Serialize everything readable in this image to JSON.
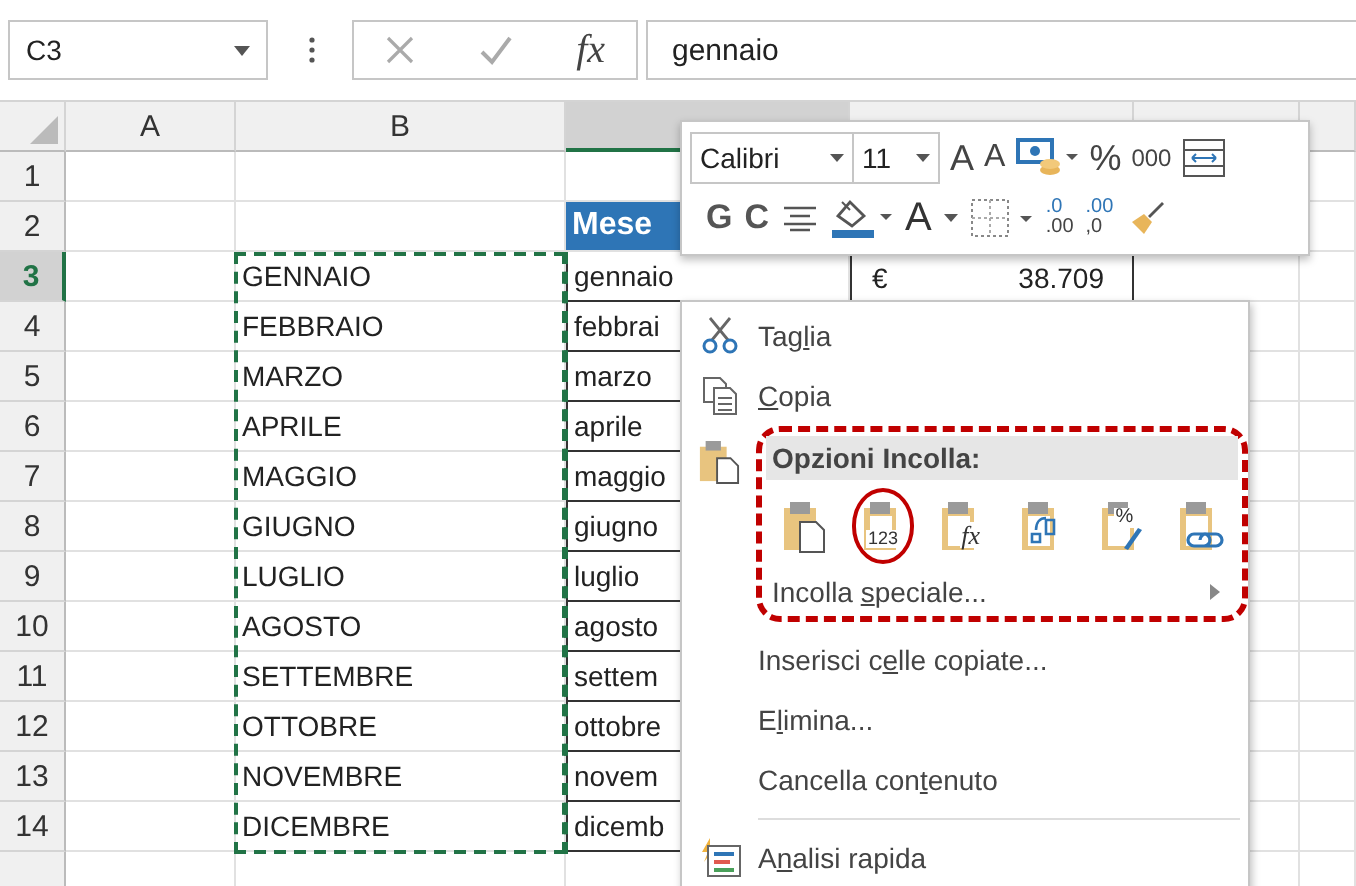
{
  "name_box": {
    "value": "C3"
  },
  "formula_bar": {
    "fx": "fx",
    "value": "gennaio"
  },
  "columns": [
    {
      "label": "A",
      "selected": false
    },
    {
      "label": "B",
      "selected": false
    },
    {
      "selected": true
    }
  ],
  "rows": [
    {
      "number": "1",
      "selected": false
    },
    {
      "number": "2",
      "selected": false,
      "c": {
        "text": "Mese",
        "kind": "header"
      }
    },
    {
      "number": "3",
      "selected": true,
      "b": "GENNAIO",
      "c": {
        "text": "gennaio",
        "kind": "table"
      },
      "d": {
        "currency": "€",
        "amount": "38.709"
      }
    },
    {
      "number": "4",
      "selected": false,
      "b": "FEBBRAIO",
      "c": {
        "text": "febbrai",
        "kind": "table"
      }
    },
    {
      "number": "5",
      "selected": false,
      "b": "MARZO",
      "c": {
        "text": "marzo",
        "kind": "table"
      }
    },
    {
      "number": "6",
      "selected": false,
      "b": "APRILE",
      "c": {
        "text": "aprile",
        "kind": "table"
      }
    },
    {
      "number": "7",
      "selected": false,
      "b": "MAGGIO",
      "c": {
        "text": "maggio",
        "kind": "table"
      }
    },
    {
      "number": "8",
      "selected": false,
      "b": "GIUGNO",
      "c": {
        "text": "giugno",
        "kind": "table"
      }
    },
    {
      "number": "9",
      "selected": false,
      "b": "LUGLIO",
      "c": {
        "text": "luglio",
        "kind": "table"
      }
    },
    {
      "number": "10",
      "selected": false,
      "b": "AGOSTO",
      "c": {
        "text": "agosto",
        "kind": "table"
      }
    },
    {
      "number": "11",
      "selected": false,
      "b": "SETTEMBRE",
      "c": {
        "text": "settem",
        "kind": "table"
      }
    },
    {
      "number": "12",
      "selected": false,
      "b": "OTTOBRE",
      "c": {
        "text": "ottobre",
        "kind": "table"
      }
    },
    {
      "number": "13",
      "selected": false,
      "b": "NOVEMBRE",
      "c": {
        "text": "novem",
        "kind": "table"
      }
    },
    {
      "number": "14",
      "selected": false,
      "b": "DICEMBRE",
      "c": {
        "text": "dicemb",
        "kind": "table"
      }
    }
  ],
  "mini_toolbar": {
    "font": "Calibri",
    "size": "11",
    "grow": "A",
    "shrink": "A",
    "percent": "%",
    "thousands": "000",
    "bold": "G",
    "italic": "C",
    "font_color": "A",
    "decimals": [
      {
        "top": ".0",
        "bottom": ".00"
      },
      {
        "top": ".00",
        "bottom": ",0"
      }
    ]
  },
  "context_menu": {
    "items": [
      {
        "kind": "cut",
        "label": {
          "pre": "Tag",
          "key": "l",
          "post": "ia"
        }
      },
      {
        "kind": "copy",
        "label": {
          "key": "C",
          "post": "opia"
        }
      },
      {
        "kind": "paste",
        "title": "Opzioni Incolla:",
        "highlighted": true,
        "options": [
          {
            "kind": "paste",
            "circled": false
          },
          {
            "kind": "values",
            "glyph": "123",
            "circled": true
          },
          {
            "kind": "formulas",
            "glyph": "fx",
            "circled": false
          },
          {
            "kind": "transpose",
            "circled": false
          },
          {
            "kind": "formatting",
            "glyph": "%",
            "circled": false
          },
          {
            "kind": "link",
            "circled": false
          }
        ],
        "special": {
          "pre": "Incolla ",
          "key": "s",
          "post": "peciale..."
        }
      },
      {
        "kind": "plain",
        "label": {
          "pre": "Inserisci c",
          "key": "e",
          "post": "lle copiate..."
        }
      },
      {
        "kind": "plain",
        "label": {
          "pre": "E",
          "key": "l",
          "post": "imina..."
        }
      },
      {
        "kind": "plain",
        "label": {
          "pre": "Cancella con",
          "key": "t",
          "post": "enuto"
        }
      },
      {
        "kind": "separator"
      },
      {
        "kind": "quick",
        "label": {
          "pre": "A",
          "key": "n",
          "post": "alisi rapida"
        }
      }
    ]
  }
}
